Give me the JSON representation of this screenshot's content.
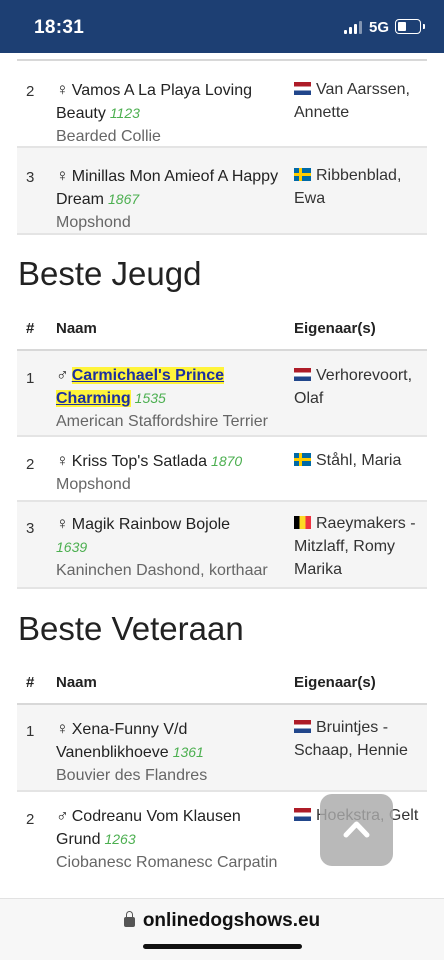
{
  "status_bar": {
    "time": "18:31",
    "network": "5G"
  },
  "table_header": {
    "rank": "#",
    "name": "Naam",
    "owner": "Eigenaar(s)"
  },
  "sections": [
    {
      "title": "",
      "rows": [
        {
          "rank": "2",
          "sex": "♀",
          "name": "Vamos A La Playa Loving Beauty",
          "cat": "1123",
          "breed": "Bearded Collie",
          "flag": "nl",
          "owner": "Van Aarssen, Annette"
        },
        {
          "rank": "3",
          "sex": "♀",
          "name": "Minillas Mon Amieof A Happy Dream",
          "cat": "1867",
          "breed": "Mopshond",
          "flag": "se",
          "owner": "Ribbenblad, Ewa"
        }
      ]
    },
    {
      "title": "Beste Jeugd",
      "rows": [
        {
          "rank": "1",
          "sex": "♂",
          "name": "Carmichael's Prince Charming",
          "cat": "1535",
          "breed": "American Staffordshire Terrier",
          "flag": "nl",
          "owner": "Verhorevoort, Olaf"
        },
        {
          "rank": "2",
          "sex": "♀",
          "name": "Kriss Top's Satlada",
          "cat": "1870",
          "breed": "Mopshond",
          "flag": "se",
          "owner": "Ståhl, Maria"
        },
        {
          "rank": "3",
          "sex": "♀",
          "name": "Magik Rainbow Bojole",
          "cat": "1639",
          "breed": "Kaninchen Dashond, korthaar",
          "flag": "be",
          "owner": "Raeymakers - Mitzlaff, Romy Marika"
        }
      ]
    },
    {
      "title": "Beste Veteraan",
      "rows": [
        {
          "rank": "1",
          "sex": "♀",
          "name": "Xena-Funny V/d Vanenblikhoeve",
          "cat": "1361",
          "breed": "Bouvier des Flandres",
          "flag": "nl",
          "owner": "Bruintjes - Schaap, Hennie"
        },
        {
          "rank": "2",
          "sex": "♂",
          "name": "Codreanu Vom Klausen Grund",
          "cat": "1263",
          "breed": "Ciobanesc Romanesc Carpatin",
          "flag": "nl",
          "owner": "Hoekstra, Gelt"
        }
      ]
    }
  ],
  "scroll_top": {
    "icon": "chevron-up-icon"
  },
  "url_bar": {
    "url": "onlinedogshows.eu",
    "icon": "lock-icon"
  },
  "colors": {
    "status_bar": "#1d3f73",
    "highlight": "#fff43a",
    "link": "#1d2fa0",
    "catalog_number": "#4caf50"
  }
}
